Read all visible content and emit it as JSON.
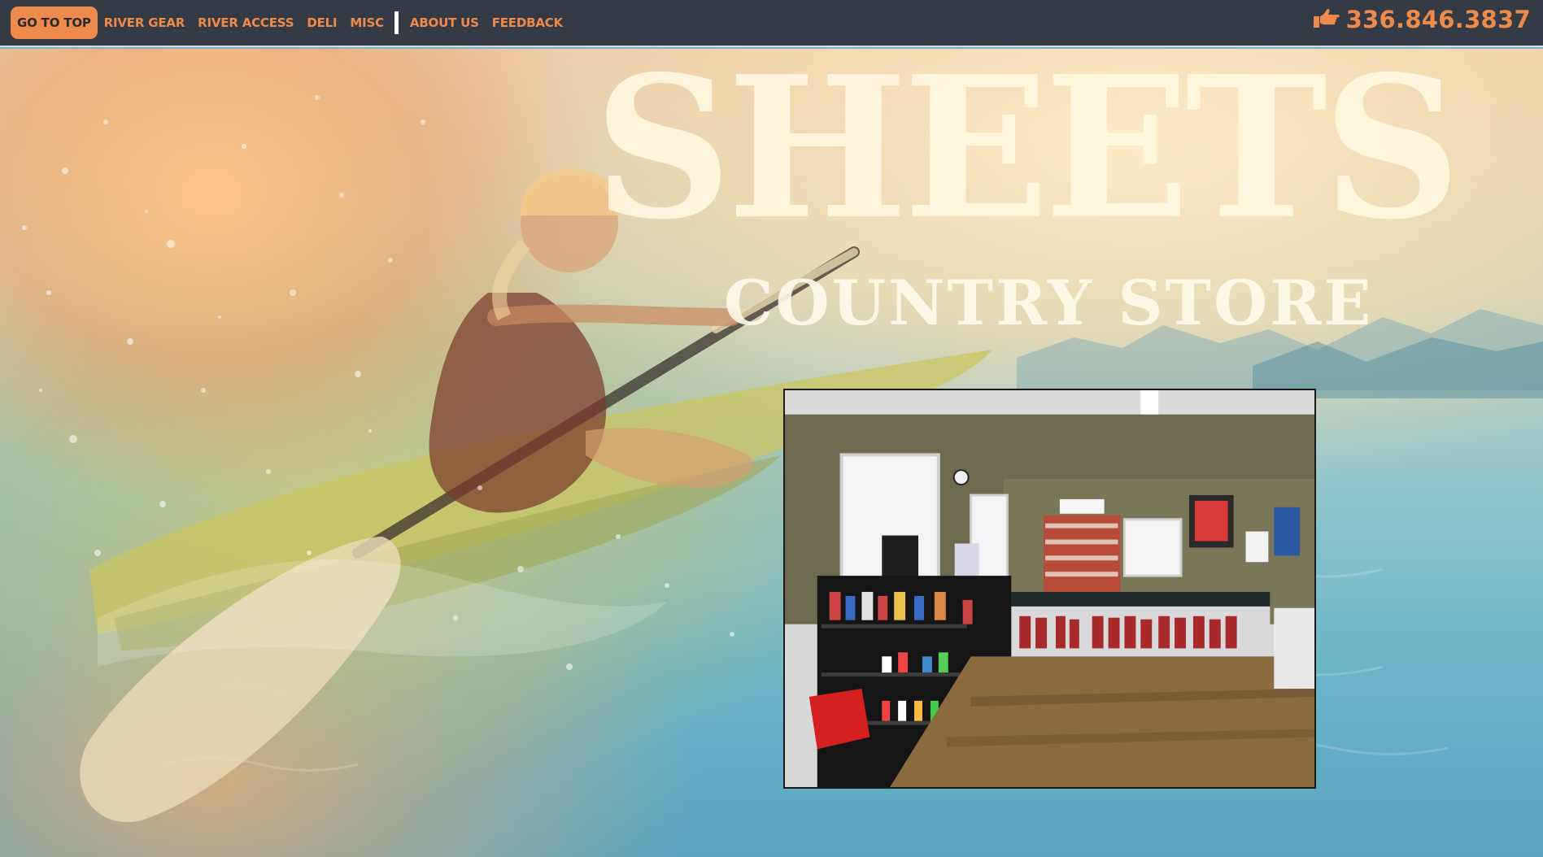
{
  "nav": {
    "items": [
      {
        "label": "GO TO TOP",
        "active": true
      },
      {
        "label": "RIVER GEAR",
        "active": false
      },
      {
        "label": "RIVER ACCESS",
        "active": false
      },
      {
        "label": "DELI",
        "active": false
      },
      {
        "label": "MISC",
        "active": false
      },
      {
        "label": "ABOUT US",
        "active": false
      },
      {
        "label": "FEEDBACK",
        "active": false
      }
    ],
    "phone": "336.846.3837",
    "phone_icon": "pointing-hand-icon"
  },
  "logo": {
    "title": "SHEETS",
    "subtitle": "COUNTRY STORE"
  },
  "colors": {
    "nav_bg": "#343b44",
    "accent": "#ef8a4d"
  }
}
